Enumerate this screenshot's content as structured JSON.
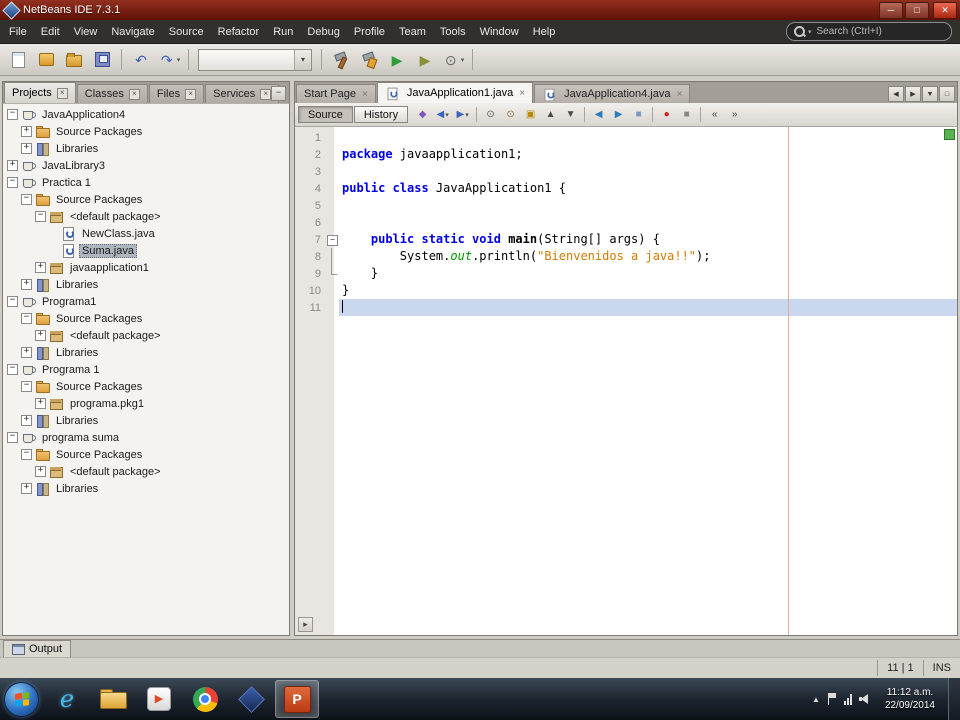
{
  "window": {
    "title": "NetBeans IDE 7.3.1",
    "controls": [
      {
        "name": "minimize-button",
        "glyph": "─"
      },
      {
        "name": "maximize-button",
        "glyph": "□"
      },
      {
        "name": "close-button",
        "glyph": "✕"
      }
    ]
  },
  "menu_bar": {
    "items": [
      "File",
      "Edit",
      "View",
      "Navigate",
      "Source",
      "Refactor",
      "Run",
      "Debug",
      "Profile",
      "Team",
      "Tools",
      "Window",
      "Help"
    ],
    "search_placeholder": "Search (Ctrl+I)"
  },
  "main_toolbar": {
    "items": [
      {
        "type": "btn",
        "name": "new-file-button",
        "icon": "new-file"
      },
      {
        "type": "btn",
        "name": "new-project-button",
        "icon": "new-project"
      },
      {
        "type": "btn",
        "name": "open-project-button",
        "icon": "open-project"
      },
      {
        "type": "btn",
        "name": "save-all-button",
        "icon": "save-all"
      },
      {
        "type": "sep"
      },
      {
        "type": "btn",
        "name": "undo-button",
        "icon": "undo",
        "glyph": "↶",
        "color": "#3a5fc0"
      },
      {
        "type": "btn",
        "name": "redo-button",
        "icon": "redo",
        "glyph": "↷",
        "color": "#3a5fc0",
        "dd": true
      },
      {
        "type": "sep"
      },
      {
        "type": "combo",
        "name": "configuration-select",
        "value": ""
      },
      {
        "type": "sep"
      },
      {
        "type": "btn",
        "name": "build-project-button",
        "icon": "build"
      },
      {
        "type": "btn",
        "name": "clean-build-project-button",
        "icon": "clean-build"
      },
      {
        "type": "btn",
        "name": "run-project-button",
        "icon": "run",
        "glyph": "▶",
        "color": "#2e9e3a"
      },
      {
        "type": "btn",
        "name": "debug-project-button",
        "icon": "debug",
        "glyph": "▶",
        "color": "#8a8f3a"
      },
      {
        "type": "btn",
        "name": "profile-project-button",
        "icon": "profile",
        "glyph": "⊙",
        "color": "#666666",
        "dd": true
      },
      {
        "type": "sep"
      }
    ]
  },
  "projects_panel": {
    "tabs": [
      {
        "label": "Projects",
        "active": true
      },
      {
        "label": "Classes",
        "active": false
      },
      {
        "label": "Files",
        "active": false
      },
      {
        "label": "Services",
        "active": false
      }
    ],
    "tree": [
      {
        "level": 0,
        "label": "JavaApplication4",
        "toggle": "-",
        "icon": "project"
      },
      {
        "level": 1,
        "label": "Source Packages",
        "toggle": "+",
        "icon": "folder"
      },
      {
        "level": 1,
        "label": "Libraries",
        "toggle": "+",
        "icon": "libraries"
      },
      {
        "level": 0,
        "label": "JavaLibrary3",
        "toggle": "+",
        "icon": "project"
      },
      {
        "level": 0,
        "label": "Practica 1",
        "toggle": "-",
        "icon": "project"
      },
      {
        "level": 1,
        "label": "Source Packages",
        "toggle": "-",
        "icon": "folder"
      },
      {
        "level": 2,
        "label": "<default package>",
        "toggle": "-",
        "icon": "package"
      },
      {
        "level": 3,
        "label": "NewClass.java",
        "toggle": "",
        "icon": "java-file"
      },
      {
        "level": 3,
        "label": "Suma.java",
        "toggle": "",
        "icon": "java-file",
        "selected": true
      },
      {
        "level": 2,
        "label": "javaapplication1",
        "toggle": "+",
        "icon": "package"
      },
      {
        "level": 1,
        "label": "Libraries",
        "toggle": "+",
        "icon": "libraries"
      },
      {
        "level": 0,
        "label": "Programa1",
        "toggle": "-",
        "icon": "project"
      },
      {
        "level": 1,
        "label": "Source Packages",
        "toggle": "-",
        "icon": "folder"
      },
      {
        "level": 2,
        "label": "<default package>",
        "toggle": "+",
        "icon": "package"
      },
      {
        "level": 1,
        "label": "Libraries",
        "toggle": "+",
        "icon": "libraries"
      },
      {
        "level": 0,
        "label": "Programa 1",
        "toggle": "-",
        "icon": "project"
      },
      {
        "level": 1,
        "label": "Source Packages",
        "toggle": "-",
        "icon": "folder"
      },
      {
        "level": 2,
        "label": "programa.pkg1",
        "toggle": "+",
        "icon": "package"
      },
      {
        "level": 1,
        "label": "Libraries",
        "toggle": "+",
        "icon": "libraries"
      },
      {
        "level": 0,
        "label": "programa suma",
        "toggle": "-",
        "icon": "project"
      },
      {
        "level": 1,
        "label": "Source Packages",
        "toggle": "-",
        "icon": "folder"
      },
      {
        "level": 2,
        "label": "<default package>",
        "toggle": "+",
        "icon": "package"
      },
      {
        "level": 1,
        "label": "Libraries",
        "toggle": "+",
        "icon": "libraries"
      }
    ]
  },
  "editor": {
    "tabs": [
      {
        "label": "Start Page",
        "active": false,
        "icon": false
      },
      {
        "label": "JavaApplication1.java",
        "active": true,
        "icon": true
      },
      {
        "label": "JavaApplication4.java",
        "active": false,
        "icon": true
      }
    ],
    "tab_controls": [
      {
        "name": "scroll-tabs-left-button",
        "glyph": "◀"
      },
      {
        "name": "scroll-tabs-right-button",
        "glyph": "▶"
      },
      {
        "name": "tab-list-button",
        "glyph": "▼"
      },
      {
        "name": "maximize-window-button",
        "glyph": "□"
      }
    ],
    "toolbar": {
      "source": "Source",
      "history": "History",
      "icons": [
        {
          "name": "last-edited-button",
          "glyph": "◆",
          "color": "#7e57c2"
        },
        {
          "name": "back-button",
          "glyph": "◀",
          "color": "#3a66c0",
          "dd": true
        },
        {
          "name": "forward-button",
          "glyph": "▶",
          "color": "#3a66c0",
          "dd": true
        },
        {
          "sep": true
        },
        {
          "name": "find-selection-button",
          "glyph": "⊙",
          "color": "#5a5a5a"
        },
        {
          "name": "find-occurrences-button",
          "glyph": "⊙",
          "color": "#8a6d3b"
        },
        {
          "name": "toggle-highlight-button",
          "glyph": "▣",
          "color": "#b58900"
        },
        {
          "name": "previous-occurrence-button",
          "glyph": "▲",
          "color": "#4a4a4a"
        },
        {
          "name": "next-occurrence-button",
          "glyph": "▼",
          "color": "#4a4a4a"
        },
        {
          "sep": true
        },
        {
          "name": "previous-bookmark-button",
          "glyph": "◀",
          "color": "#2e7dbb"
        },
        {
          "name": "next-bookmark-button",
          "glyph": "▶",
          "color": "#2e7dbb"
        },
        {
          "name": "toggle-bookmark-button",
          "glyph": "■",
          "color": "#7a99c0"
        },
        {
          "sep": true
        },
        {
          "name": "start-macro-recording-button",
          "glyph": "●",
          "color": "#cc2222"
        },
        {
          "name": "stop-macro-recording-button",
          "glyph": "■",
          "color": "#888888"
        },
        {
          "sep": true
        },
        {
          "name": "shift-line-left-button",
          "glyph": "«",
          "color": "#444444"
        },
        {
          "name": "shift-line-right-button",
          "glyph": "»",
          "color": "#444444"
        }
      ]
    },
    "code": [
      {
        "n": 1,
        "tokens": []
      },
      {
        "n": 2,
        "tokens": [
          {
            "t": "package",
            "c": "kw"
          },
          {
            "t": " javaapplication1;",
            "c": "pl"
          }
        ]
      },
      {
        "n": 3,
        "tokens": []
      },
      {
        "n": 4,
        "tokens": [
          {
            "t": "public class ",
            "c": "kw"
          },
          {
            "t": "JavaApplication1",
            "c": "cls"
          },
          {
            "t": " {",
            "c": "pl"
          }
        ]
      },
      {
        "n": 5,
        "tokens": []
      },
      {
        "n": 6,
        "tokens": []
      },
      {
        "n": 7,
        "fold": "start",
        "tokens": [
          {
            "t": "    ",
            "c": "pl"
          },
          {
            "t": "public static void ",
            "c": "kw"
          },
          {
            "t": "main",
            "c": "mth"
          },
          {
            "t": "(String[] args) {",
            "c": "pl"
          }
        ]
      },
      {
        "n": 8,
        "fold": "mid",
        "tokens": [
          {
            "t": "        System.",
            "c": "pl"
          },
          {
            "t": "out",
            "c": "fld"
          },
          {
            "t": ".println(",
            "c": "pl"
          },
          {
            "t": "\"Bienvenidos a java!!\"",
            "c": "str"
          },
          {
            "t": ");",
            "c": "pl"
          }
        ]
      },
      {
        "n": 9,
        "fold": "end",
        "tokens": [
          {
            "t": "    }",
            "c": "pl"
          }
        ]
      },
      {
        "n": 10,
        "tokens": [
          {
            "t": "}",
            "c": "pl"
          }
        ]
      },
      {
        "n": 11,
        "current": true,
        "tokens": []
      }
    ]
  },
  "output_panel": {
    "label": "Output"
  },
  "status_bar": {
    "caret_position": "11 | 1",
    "insert_mode": "INS"
  },
  "taskbar": {
    "items": [
      {
        "name": "taskbar-internet-explorer",
        "icon": "ie",
        "glyph": "e"
      },
      {
        "name": "taskbar-windows-explorer",
        "icon": "folder"
      },
      {
        "name": "taskbar-media-player",
        "icon": "media",
        "glyph": "▶"
      },
      {
        "name": "taskbar-chrome",
        "icon": "chrome"
      },
      {
        "name": "taskbar-netbeans",
        "icon": "cube"
      },
      {
        "name": "taskbar-powerpoint",
        "icon": "ppt",
        "glyph": "P",
        "active": true
      }
    ],
    "clock": {
      "time": "11:12 a.m.",
      "date": "22/09/2014"
    }
  }
}
